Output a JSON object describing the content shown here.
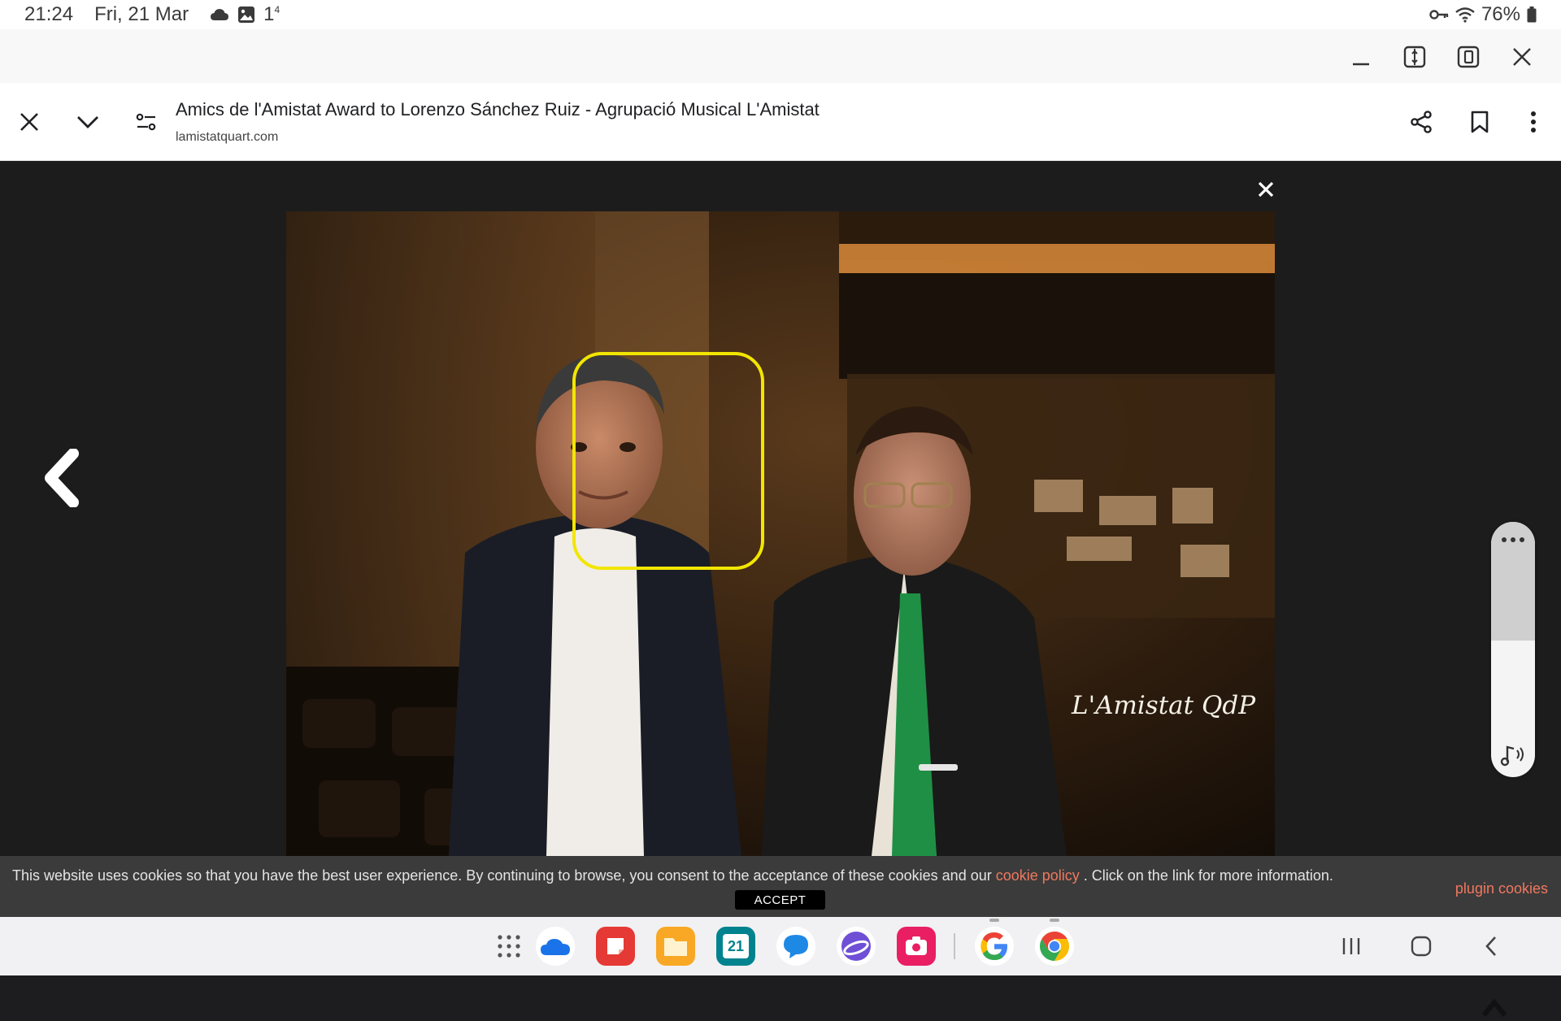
{
  "status_bar": {
    "time": "21:24",
    "date": "Fri, 21 Mar",
    "notification_count": "1",
    "notification_sup": "4",
    "battery": "76%"
  },
  "window_controls": {
    "minimize_icon": "minimize-icon",
    "split_icon": "split-view-icon",
    "popup_icon": "popup-view-icon",
    "close_icon": "close-icon"
  },
  "browser": {
    "page_title": "Amics de l'Amistat Award to Lorenzo Sánchez Ruiz - Agrupació Musical L'Amistat",
    "url": "lamistatquart.com"
  },
  "lightbox": {
    "watermark": "L'Amistat QdP"
  },
  "cookie_banner": {
    "text_before": "This website uses cookies so that you have the best user experience. By continuing to browse, you consent to the acceptance of these cookies and our ",
    "link_label": "cookie policy",
    "text_after": " . Click on the link for more information.",
    "accept_label": "ACCEPT",
    "plugin_label": "plugin cookies"
  },
  "taskbar": {
    "calendar_day": "21",
    "apps": [
      "apps-grid-icon",
      "onedrive-icon",
      "notes-icon",
      "my-files-icon",
      "calendar-icon",
      "messages-icon",
      "internet-icon",
      "screen-recorder-icon",
      "google-icon",
      "chrome-icon"
    ],
    "nav": [
      "recents-icon",
      "home-icon",
      "back-icon"
    ]
  },
  "colors": {
    "face_highlight": "#f2e600",
    "link": "#f0785f",
    "cookie_bg": "#3b3b3b"
  }
}
